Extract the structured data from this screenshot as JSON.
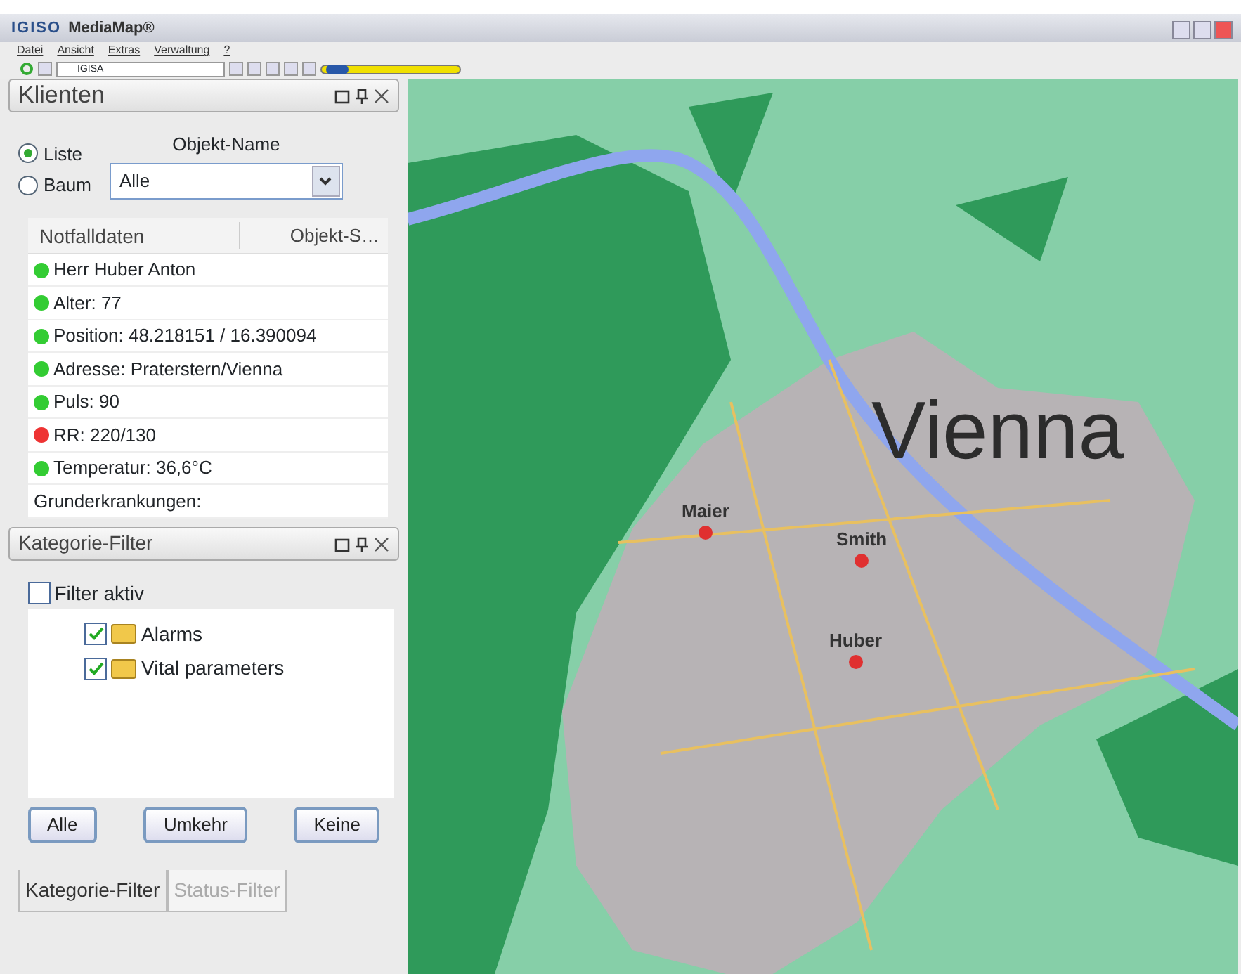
{
  "window": {
    "title": "MediaMap®",
    "logo": "IGISO"
  },
  "menu": [
    "Datei",
    "Ansicht",
    "Extras",
    "Verwaltung",
    "?"
  ],
  "toolbar": {
    "layer_combo": "IGISA",
    "zoom_slider": {
      "level": 0.03
    }
  },
  "clients_panel": {
    "title": "Klienten",
    "view_options": [
      {
        "label": "Liste",
        "selected": true
      },
      {
        "label": "Baum",
        "selected": false
      }
    ],
    "object_name_label": "Objekt-Name",
    "object_name_value": "Alle",
    "table": {
      "columns": [
        "Notfalldaten",
        "Objekt-S…"
      ],
      "rows": [
        {
          "text": "Herr Huber Anton",
          "color": "#33cc33"
        },
        {
          "text": "Alter: 77",
          "color": "#33cc33"
        },
        {
          "text": "Position: 48.218151 / 16.390094",
          "color": "#33cc33"
        },
        {
          "text": "Adresse: Praterstern/Vienna",
          "color": "#33cc33"
        },
        {
          "text": "Puls: 90",
          "color": "#33cc33"
        },
        {
          "text": "RR: 220/130",
          "color": "#ee3333"
        },
        {
          "text": "Temperatur: 36,6°C",
          "color": "#33cc33"
        },
        {
          "text": "Grunderkrankungen:"
        }
      ]
    }
  },
  "filter_panel": {
    "title": "Kategorie-Filter",
    "filter_active": {
      "label": "Filter aktiv",
      "checked": false
    },
    "categories": [
      {
        "label": "Alarms",
        "checked": true
      },
      {
        "label": "Vital parameters",
        "checked": true
      }
    ],
    "buttons": [
      "Alle",
      "Umkehr",
      "Keine"
    ]
  },
  "bottom_tabs": [
    {
      "label": "Kategorie-Filter",
      "selected": true
    },
    {
      "label": "Status-Filter",
      "selected": false
    }
  ],
  "map": {
    "city_label": "Vienna",
    "markers": [
      {
        "label": "Maier"
      },
      {
        "label": "Smith"
      },
      {
        "label": "Huber"
      }
    ]
  }
}
